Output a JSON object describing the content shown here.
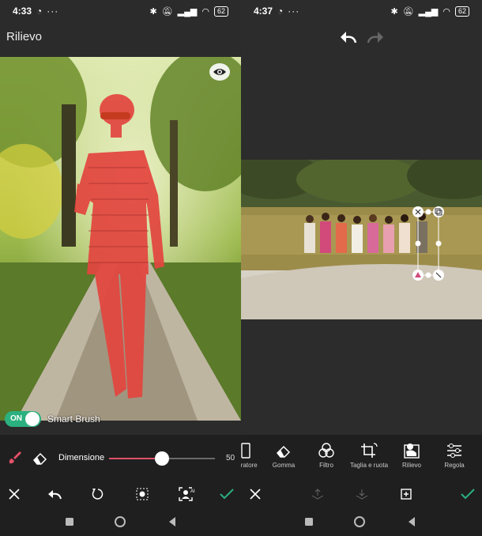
{
  "left": {
    "status": {
      "time": "4:33",
      "battery": "62"
    },
    "title": "Rilievo",
    "smart_brush": {
      "state": "ON",
      "label": "Smart Brush"
    },
    "brush_size": {
      "label": "Dimensione",
      "value": "50",
      "fraction": 0.5
    }
  },
  "right": {
    "status": {
      "time": "4:37",
      "battery": "62"
    },
    "tools": [
      {
        "label": "...iratore",
        "icon": "phone-icon"
      },
      {
        "label": "Gomma",
        "icon": "eraser-icon"
      },
      {
        "label": "Filtro",
        "icon": "filter-icon"
      },
      {
        "label": "Taglia e ruota",
        "icon": "crop-rotate-icon"
      },
      {
        "label": "Rilievo",
        "icon": "cutout-icon"
      },
      {
        "label": "Regola",
        "icon": "adjust-icon"
      }
    ]
  },
  "colors": {
    "accent": "#2bb07f",
    "mask": "#e3463f",
    "slider": "#e0506a"
  }
}
